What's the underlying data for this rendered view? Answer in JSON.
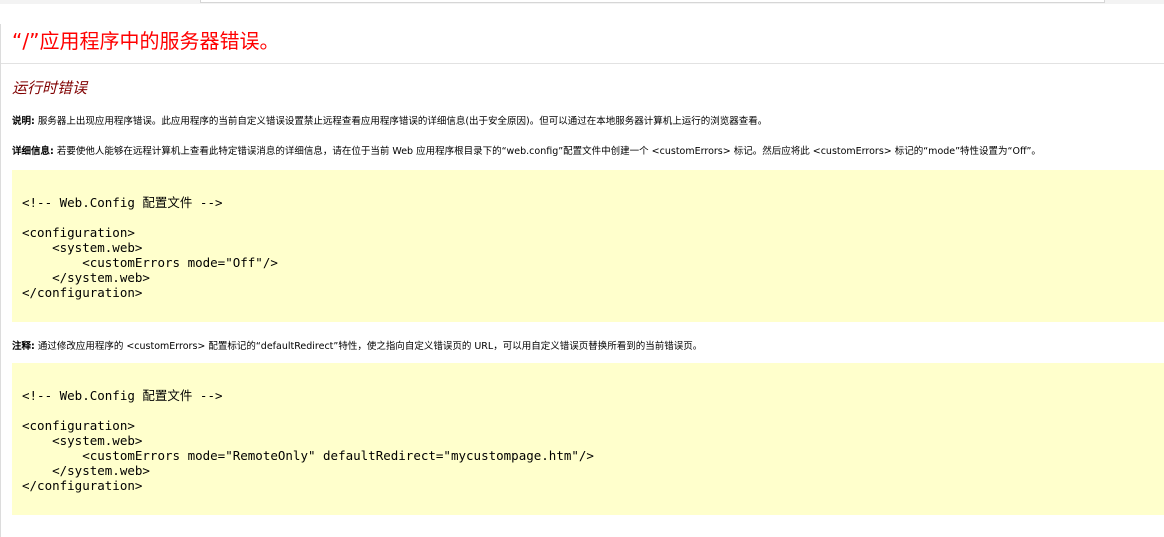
{
  "page": {
    "title": "“/”应用程序中的服务器错误。",
    "section_title": "运行时错误"
  },
  "description": {
    "label": "说明:",
    "text": " 服务器上出现应用程序错误。此应用程序的当前自定义错误设置禁止远程查看应用程序错误的详细信息(出于安全原因)。但可以通过在本地服务器计算机上运行的浏览器查看。"
  },
  "details": {
    "label": "详细信息:",
    "text": " 若要使他人能够在远程计算机上查看此特定错误消息的详细信息，请在位于当前 Web 应用程序根目录下的“web.config”配置文件中创建一个 <customErrors> 标记。然后应将此 <customErrors> 标记的“mode”特性设置为“Off”。"
  },
  "code_block_1": {
    "lines": [
      "<!-- Web.Config 配置文件 -->",
      "",
      "<configuration>",
      "    <system.web>",
      "        <customErrors mode=\"Off\"/>",
      "    </system.web>",
      "</configuration>"
    ]
  },
  "note": {
    "label": "注释:",
    "text": " 通过修改应用程序的 <customErrors> 配置标记的“defaultRedirect”特性，使之指向自定义错误页的 URL，可以用自定义错误页替换所看到的当前错误页。"
  },
  "code_block_2": {
    "lines": [
      "<!-- Web.Config 配置文件 -->",
      "",
      "<configuration>",
      "    <system.web>",
      "        <customErrors mode=\"RemoteOnly\" defaultRedirect=\"mycustompage.htm\"/>",
      "    </system.web>",
      "</configuration>"
    ]
  },
  "colors": {
    "title": "#ff0000",
    "section_title": "#800000",
    "code_background": "#ffffcc"
  }
}
